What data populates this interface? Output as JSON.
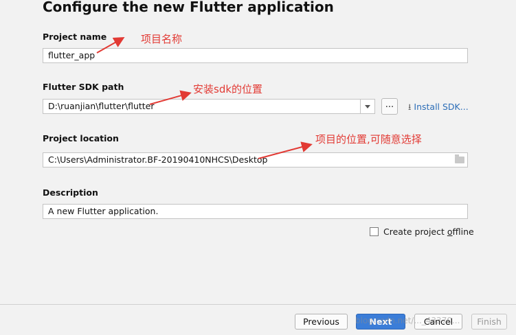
{
  "title": "Configure the new Flutter application",
  "project_name": {
    "label": "Project name",
    "value": "flutter_app"
  },
  "sdk_path": {
    "label": "Flutter SDK path",
    "value": "D:\\ruanjian\\flutter\\flutter",
    "browse_label": "...",
    "install_label": "Install SDK..."
  },
  "project_location": {
    "label": "Project location",
    "value": "C:\\Users\\Administrator.BF-20190410NHCS\\Desktop"
  },
  "description": {
    "label": "Description",
    "value": "A new Flutter application."
  },
  "offline": {
    "label_prefix": "Create project ",
    "label_underlined": "o",
    "label_suffix": "ffline",
    "checked": false
  },
  "annotations": {
    "name_note": "项目名称",
    "sdk_note": "安装sdk的位置",
    "location_note": "项目的位置,可随意选择",
    "color": "#e23a34"
  },
  "footer": {
    "previous": "Previous",
    "next": "Next",
    "cancel": "Cancel",
    "finish": "Finish"
  },
  "watermark": "blog.csdn.net/..._43370..."
}
